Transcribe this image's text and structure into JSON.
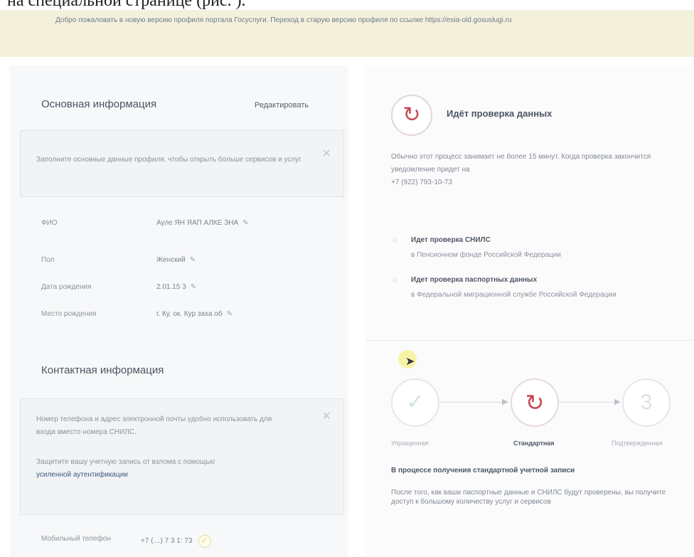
{
  "doc_header": "на специальной странице (рис. ).",
  "banner": {
    "text": "Добро пожаловать в новую версию профиля портала Госуслуги. Переход в старую версию профиля по ссылке https://esia-old.gosuslugi.ru"
  },
  "left": {
    "main_info": {
      "title": "Основная информация",
      "edit_label": "Редактировать",
      "notice": "Заполните основные данные профиля, чтобы открыть больше сервисов и услуг",
      "close_glyph": "×",
      "rows": [
        {
          "label": "ФИО",
          "value": "Ауле ЯН ЯАП АЛКЕ ЗНА"
        },
        {
          "label": "Пол",
          "value": "Женский"
        },
        {
          "label": "Дата рождения",
          "value": "2.01.15 3"
        },
        {
          "label": "Место рождения",
          "value": "г. Ку. ок. Кур заха об"
        }
      ],
      "edit_glyph": "✎"
    },
    "contact_info": {
      "title": "Контактная информация",
      "notice_1": "Номер телефона и адрес электронной почты удобно использовать для входа вместо номера СНИЛС.",
      "notice_2": "Защитите вашу учетную запись от взлома с помощью",
      "notice_link": "усиленной аутентификации",
      "close_glyph": "×",
      "mobile_label": "Мобильный телефон",
      "mobile_value": "+7 (…) 7 3 1: 73",
      "mobile_ok": "✓"
    }
  },
  "right": {
    "status_glyph": "↻",
    "status_title": "Идёт проверка данных",
    "description": "Обычно этот процесс занимает не более 15 минут. Когда проверка закончится уведомление придет на",
    "phone": "+7 (922) 793-10-73",
    "checks": [
      {
        "title": "Идет проверка СНИЛС",
        "sub": "в Пенсионном фонде Российской Федерации"
      },
      {
        "title": "Идет проверка паспортных данных",
        "sub": "в Федеральной миграционной службе Российской Федерации"
      }
    ],
    "check_glyph": "○",
    "cursor_glyph": "➤",
    "steps": [
      {
        "label": "Упрощенная",
        "glyph": "✓"
      },
      {
        "label": "Стандартная",
        "glyph": "↻"
      },
      {
        "label": "Подтвержденная",
        "glyph": "3"
      }
    ],
    "arrow_glyph": "▶",
    "process_title": "В процессе получения стандартной учетной записи",
    "process_text": "После того, как ваши паспортные данные и СНИЛС будут проверены, вы получите доступ к большому количеству услуг и сервисов"
  }
}
